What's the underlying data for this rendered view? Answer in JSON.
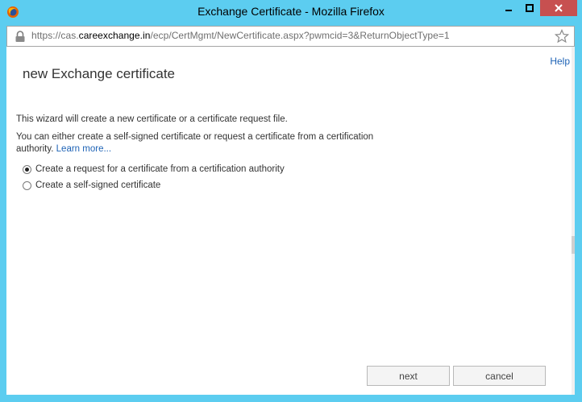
{
  "window": {
    "title": "Exchange Certificate - Mozilla Firefox",
    "url_prefix": "https://cas.",
    "url_host": "careexchange.in",
    "url_rest": "/ecp/CertMgmt/NewCertificate.aspx?pwmcid=3&ReturnObjectType=1"
  },
  "page": {
    "help_label": "Help",
    "title": "new Exchange certificate",
    "intro_text": "This wizard will create a new certificate or a certificate request file.",
    "description_text": "You can either create a self-signed certificate or request a certificate from a certification authority.",
    "learn_more_label": "Learn more...",
    "options": [
      {
        "label": "Create a request for a certificate from a certification authority",
        "selected": true
      },
      {
        "label": "Create a self-signed certificate",
        "selected": false
      }
    ],
    "next_label": "next",
    "cancel_label": "cancel"
  },
  "colors": {
    "frame": "#5ccdf0",
    "close_button": "#c75050",
    "link": "#1e63b6"
  }
}
